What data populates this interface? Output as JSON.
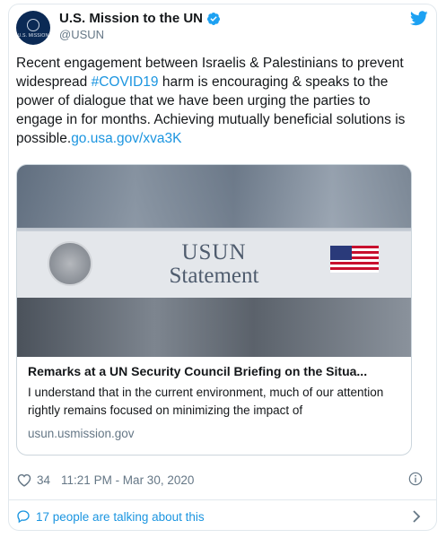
{
  "account": {
    "name": "U.S. Mission to the UN",
    "handle": "@USUN",
    "avatar_text": "U.S. MISSION"
  },
  "tweet": {
    "text_before": "Recent engagement between Israelis & Palestinians to prevent widespread ",
    "hashtag": "#COVID19",
    "text_after": " harm is encouraging & speaks to the power of dialogue that we have been urging the parties to engage in for months. Achieving mutually beneficial solutions is possible.",
    "link": "go.usa.gov/xva3K"
  },
  "card": {
    "image_title_line1": "USUN",
    "image_title_line2": "Statement",
    "title": "Remarks at a UN Security Council Briefing on the Situa...",
    "description": "I understand that in the current environment, much of our attention rightly remains focused on minimizing the impact of",
    "domain": "usun.usmission.gov"
  },
  "meta": {
    "likes": "34",
    "timestamp": "11:21 PM - Mar 30, 2020"
  },
  "footer": {
    "talking": "17 people are talking about this"
  },
  "colors": {
    "link": "#1b95e0",
    "secondary": "#657786",
    "border": "#e1e8ed"
  },
  "icons": [
    "verified-badge-icon",
    "twitter-bird-icon",
    "heart-icon",
    "info-icon",
    "comment-bubble-icon",
    "chevron-right-icon"
  ]
}
